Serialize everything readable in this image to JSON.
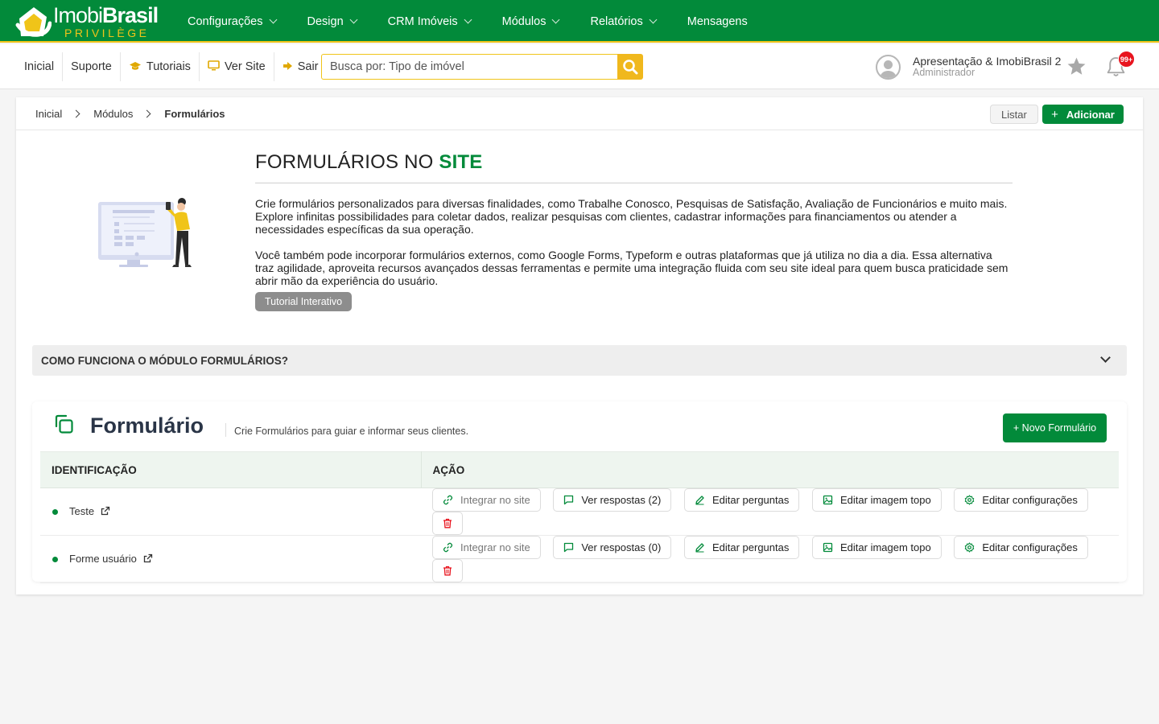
{
  "brand": {
    "name_light": "Imobi",
    "name_bold": "Brasil",
    "tagline": "PRIVILÈGE",
    "primary": "#028a3a",
    "accent": "#f0c419"
  },
  "main_nav": [
    {
      "label": "Configurações",
      "dropdown": true
    },
    {
      "label": "Design",
      "dropdown": true
    },
    {
      "label": "CRM Imóveis",
      "dropdown": true
    },
    {
      "label": "Módulos",
      "dropdown": true
    },
    {
      "label": "Relatórios",
      "dropdown": true
    },
    {
      "label": "Mensagens",
      "dropdown": false
    }
  ],
  "sub_nav": [
    {
      "label": "Inicial",
      "icon": ""
    },
    {
      "label": "Suporte",
      "icon": ""
    },
    {
      "label": "Tutoriais",
      "icon": "graduation-cap-icon"
    },
    {
      "label": "Ver Site",
      "icon": "monitor-icon"
    },
    {
      "label": "Sair",
      "icon": "sign-out-icon"
    }
  ],
  "search": {
    "placeholder": "Busca por: Tipo de imóvel",
    "value": ""
  },
  "user": {
    "name": "Apresentação & ImobiBrasil 2",
    "role": "Administrador"
  },
  "notifications": {
    "count": "99+"
  },
  "breadcrumb": {
    "items": [
      "Inicial",
      "Módulos"
    ],
    "current": "Formulários"
  },
  "toolbar": {
    "list_label": "Listar",
    "add_label": "Adicionar"
  },
  "intro": {
    "title_plain": "FORMULÁRIOS NO ",
    "title_accent": "SITE",
    "p1": "Crie formulários personalizados para diversas finalidades, como Trabalhe Conosco, Pesquisas de Satisfação, Avaliação de Funcionários e muito mais. Explore infinitas possibilidades para coletar dados, realizar pesquisas com clientes, cadastrar informações para financiamentos ou atender a necessidades específicas da sua operação.",
    "p2": "Você também pode incorporar formulários externos, como Google Forms, Typeform e outras plataformas que já utiliza no dia a dia. Essa alternativa traz agilidade, aproveita recursos avançados dessas ferramentas e permite uma integração fluida com seu site ideal para quem busca praticidade sem abrir mão da experiência do usuário.",
    "tutorial_label": "Tutorial Interativo"
  },
  "accordion": {
    "title": "COMO FUNCIONA O MÓDULO FORMULÁRIOS?"
  },
  "forms_panel": {
    "title": "Formulário",
    "subtitle": "Crie Formulários para guiar e informar seus clientes.",
    "new_label": "+ Novo Formulário",
    "columns": [
      "IDENTIFICAÇÃO",
      "AÇÃO"
    ],
    "rows": [
      {
        "name": "Teste",
        "status": "active",
        "responses_label": "Ver respostas (2)"
      },
      {
        "name": "Forme usuário",
        "status": "active",
        "responses_label": "Ver respostas (0)"
      }
    ],
    "actions": {
      "integrate": "Integrar no site",
      "edit_questions": "Editar perguntas",
      "edit_image": "Editar imagem topo",
      "edit_settings": "Editar configurações"
    }
  }
}
